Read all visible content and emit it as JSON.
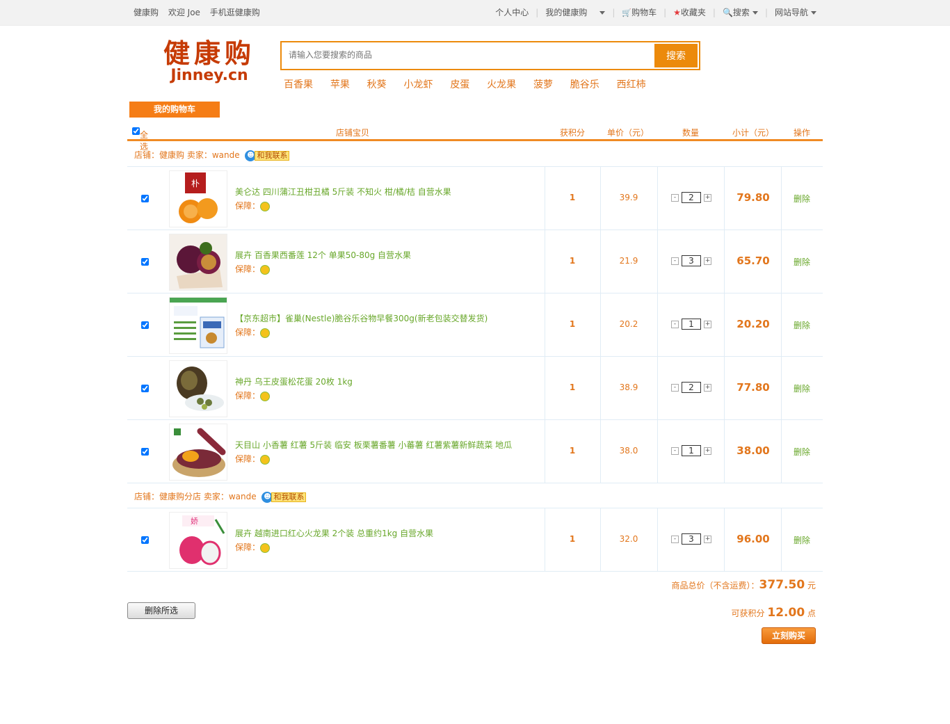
{
  "topbar": {
    "left": [
      "健康购",
      "欢迎 Joe",
      "手机逛健康购"
    ],
    "right": [
      "个人中心",
      "我的健康购",
      "购物车",
      "收藏夹",
      "搜索",
      "网站导航"
    ]
  },
  "logo": {
    "cn": "健康购",
    "en": "Jinney.cn"
  },
  "search": {
    "placeholder": "请输入您要搜索的商品",
    "button": "搜索"
  },
  "hot_keywords": [
    "百香果",
    "苹果",
    "秋葵",
    "小龙虾",
    "皮蛋",
    "火龙果",
    "菠萝",
    "脆谷乐",
    "西红柿"
  ],
  "cart": {
    "tab": "我的购物车",
    "headers": {
      "select_all": "全选",
      "item": "店铺宝贝",
      "points": "获积分",
      "unit_price": "单价（元）",
      "qty": "数量",
      "subtotal": "小计（元）",
      "op": "操作"
    },
    "shops": [
      {
        "label": "店铺：健康购",
        "seller": "卖家：wande",
        "contact": "和我联系"
      },
      {
        "label": "店铺：健康购分店",
        "seller": "卖家：wande",
        "contact": "和我联系"
      }
    ],
    "guarantee": "保障：",
    "delete": "删除",
    "items": [
      {
        "title": "美仑达 四川蒲江丑柑丑橘 5斤装 不知火 柑/橘/桔 自营水果",
        "points": "1",
        "price": "39.9",
        "qty": "2",
        "subtotal": "79.80",
        "image": "orange-image"
      },
      {
        "title": "展卉 百香果西番莲 12个 单果50-80g 自营水果",
        "points": "1",
        "price": "21.9",
        "qty": "3",
        "subtotal": "65.70",
        "image": "passion-fruit-image"
      },
      {
        "title": "【京东超市】雀巢(Nestle)脆谷乐谷物早餐300g(新老包装交替发货)",
        "points": "1",
        "price": "20.2",
        "qty": "1",
        "subtotal": "20.20",
        "image": "cereal-box-image"
      },
      {
        "title": "神丹 乌王皮蛋松花蛋 20枚 1kg",
        "points": "1",
        "price": "38.9",
        "qty": "2",
        "subtotal": "77.80",
        "image": "century-egg-image"
      },
      {
        "title": "天目山 小香薯 红薯 5斤装 临安 板栗薯番薯 小蕃薯 红薯紫薯新鲜蔬菜 地瓜",
        "points": "1",
        "price": "38.0",
        "qty": "1",
        "subtotal": "38.00",
        "image": "sweet-potato-image"
      },
      {
        "title": "展卉 越南进口红心火龙果 2个装 总重约1kg 自营水果",
        "points": "1",
        "price": "32.0",
        "qty": "3",
        "subtotal": "96.00",
        "image": "dragon-fruit-image"
      }
    ],
    "total_label": "商品总价（不含运费）：",
    "total": "377.50",
    "total_unit": "元",
    "points_label": "可获积分",
    "points_total": "12.00",
    "points_unit": "点",
    "delete_selected": "删除所选",
    "buy_now": "立刻购买"
  }
}
